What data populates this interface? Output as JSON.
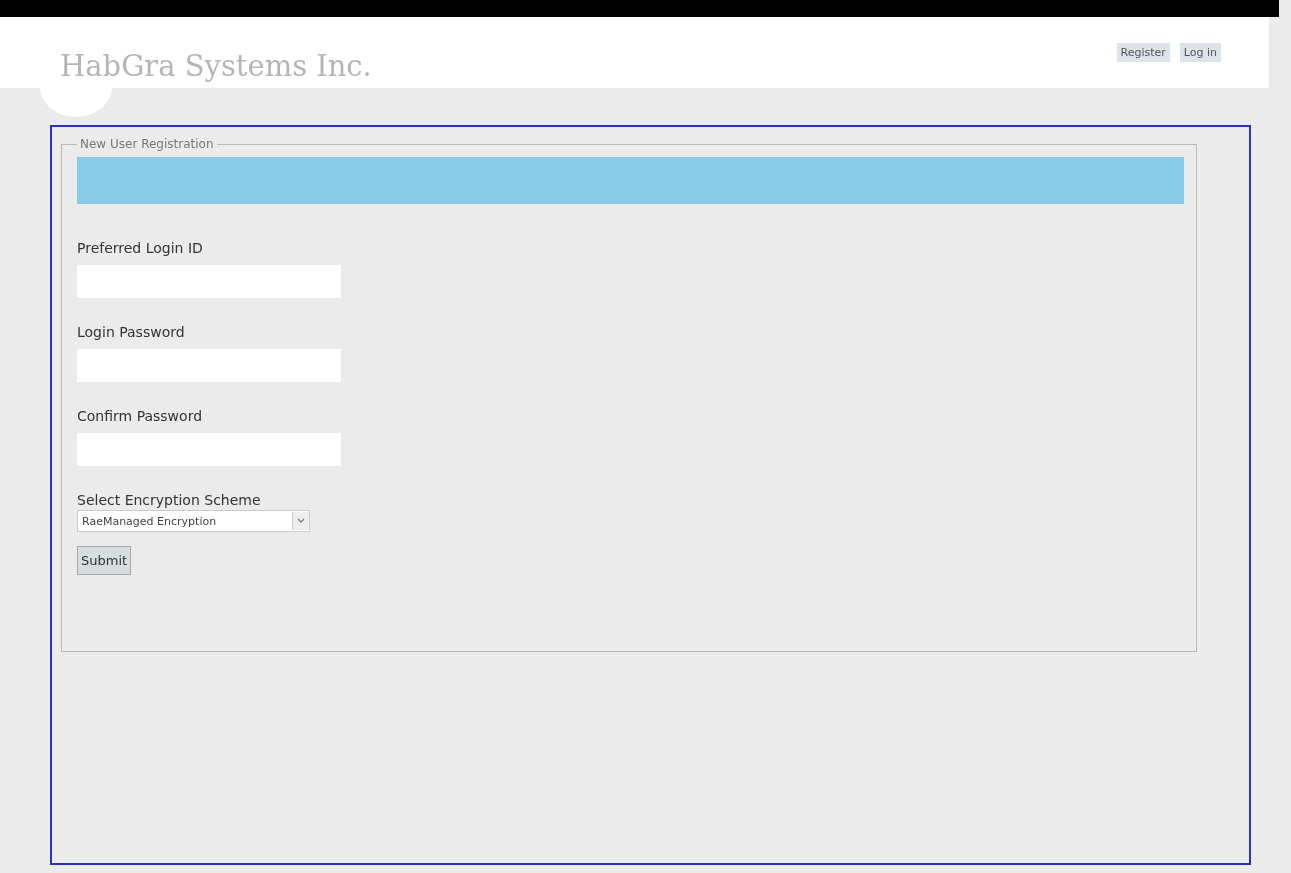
{
  "header": {
    "logo": "HabGra Systems Inc.",
    "links": [
      {
        "label": "Register"
      },
      {
        "label": "Log in"
      }
    ]
  },
  "form": {
    "legend": "New User Registration",
    "fields": [
      {
        "kind": "text",
        "label": "Preferred Login ID"
      },
      {
        "kind": "text",
        "label": "Login Password"
      },
      {
        "kind": "text",
        "label": "Confirm Password"
      },
      {
        "kind": "select",
        "label": "Select Encryption Scheme",
        "value": "RaeManaged Encryption"
      }
    ],
    "submit": "Submit"
  }
}
